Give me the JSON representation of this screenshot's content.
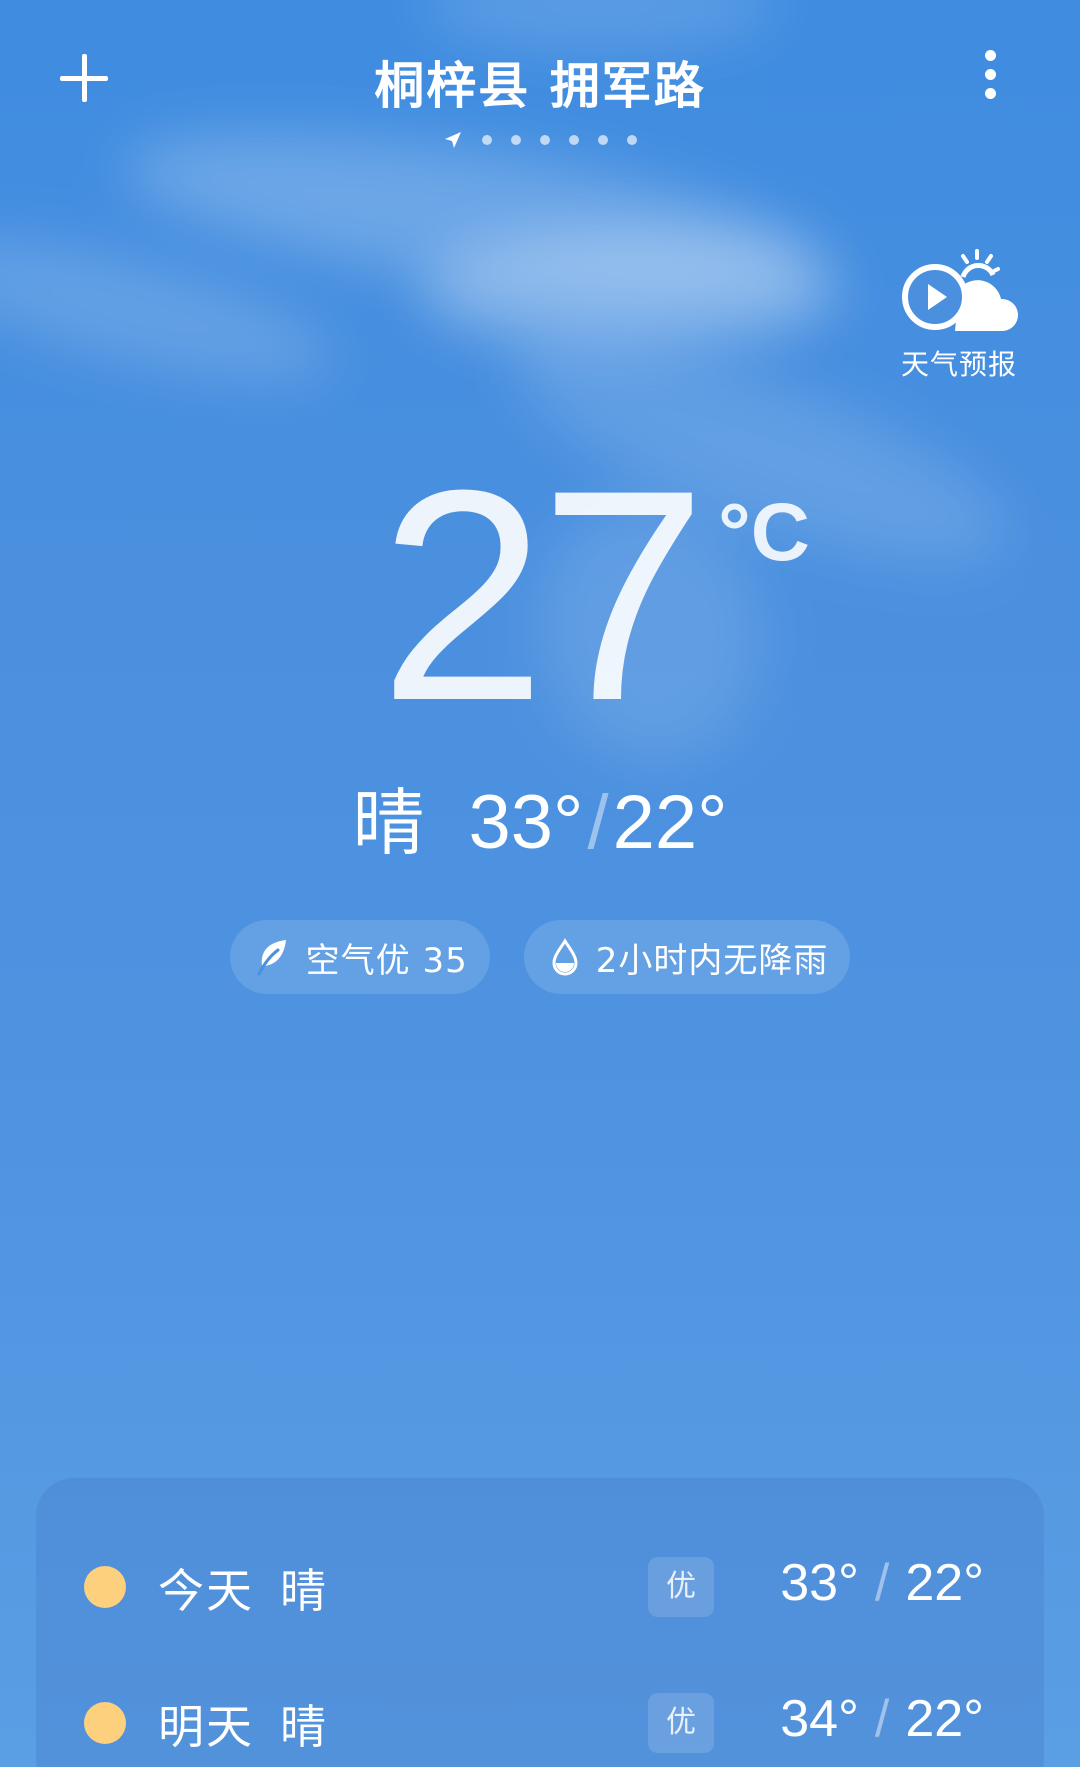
{
  "header": {
    "location": "桐梓县 拥军路",
    "page_dot_count": 6
  },
  "forecast_video": {
    "label": "天气预报",
    "icon": "play-cloud-sun-icon"
  },
  "current": {
    "temperature": "27",
    "unit": "°C",
    "condition": "晴",
    "high": "33°",
    "low": "22°"
  },
  "chips": {
    "air_quality": "空气优 35",
    "rain": "2小时内无降雨"
  },
  "daily": [
    {
      "day": "今天",
      "condition": "晴",
      "aqi": "优",
      "high": "33°",
      "low": "22°",
      "color": "#fcd07c"
    },
    {
      "day": "明天",
      "condition": "晴",
      "aqi": "优",
      "high": "34°",
      "low": "22°",
      "color": "#fcd07c"
    }
  ],
  "colors": {
    "sky_top": "#3f8ce0",
    "sky_bottom": "#5a9ee4",
    "sun": "#fcd07c"
  }
}
